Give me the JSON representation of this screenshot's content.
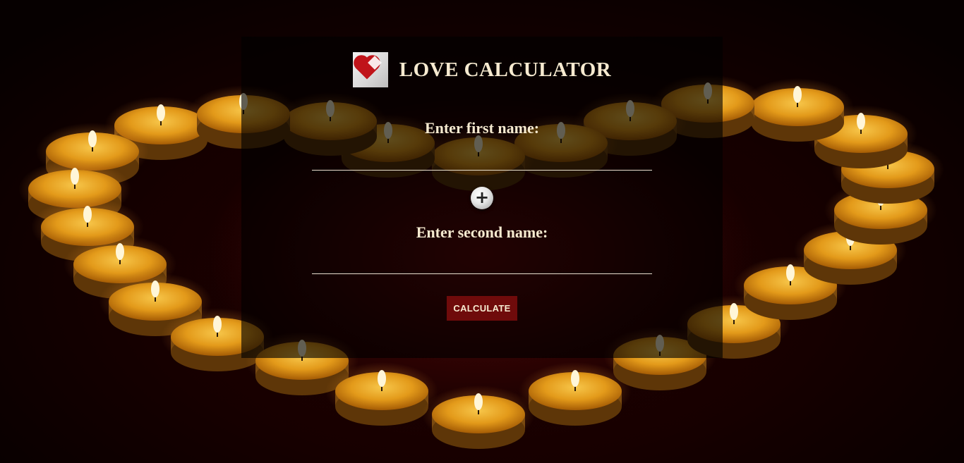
{
  "page": {
    "title": "LOVE CALCULATOR",
    "logo_icon": "heart-logo-icon"
  },
  "form": {
    "first_label": "Enter first name:",
    "first_value": "",
    "second_label": "Enter second name:",
    "second_value": "",
    "plus_icon": "plus-circle-icon",
    "plus_glyph": "+",
    "calculate_label": "CALCULATE"
  },
  "colors": {
    "background": "#1a0101",
    "panel": "rgba(0,0,0,0.62)",
    "text": "#f6ead0",
    "button": "#6f0b0b",
    "candle": "#e9a21f"
  }
}
